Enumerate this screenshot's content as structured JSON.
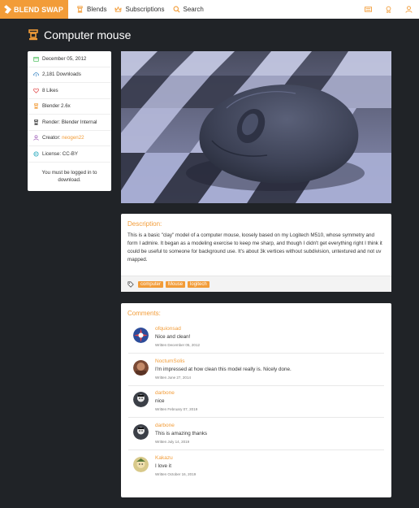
{
  "nav": {
    "brand": "BLEND SWAP",
    "items": [
      {
        "label": "Blends",
        "icon": "blender-icon"
      },
      {
        "label": "Subscriptions",
        "icon": "crown-icon"
      },
      {
        "label": "Search",
        "icon": "search-icon"
      }
    ],
    "right_icons": [
      "newspaper-icon",
      "award-icon",
      "user-icon"
    ]
  },
  "page": {
    "title": "Computer mouse"
  },
  "info": {
    "date": "December 05, 2012",
    "downloads": "2,181 Downloads",
    "likes": "8 Likes",
    "blender": "Blender 2.6x",
    "render": "Render: Blender Internal",
    "creator_label": "Creator:",
    "creator": "neogen22",
    "license": "License: CC-BY",
    "login_note": "You must be logged in to download."
  },
  "description": {
    "title": "Description:",
    "text": "This is a basic \"clay\" model of a computer mouse, loosely based on my Logitech M510, whose symmetry and form I admire. It began as a modeling exercise to keep me sharp, and though I didn't get everything right I think it could be useful to someone for background use. It's about 3k vertices without subdivision, untextured and not uv mapped.",
    "tags": [
      "computer",
      "Mouse",
      "logitech"
    ]
  },
  "comments": {
    "title": "Comments:",
    "items": [
      {
        "author": "ofquionsad",
        "text": "Nice and clean!",
        "date": "Written December 05, 2012"
      },
      {
        "author": "NoctumSolis",
        "text": "I'm impressed at how clean this model really is. Nicely done.",
        "date": "Written June 27, 2014"
      },
      {
        "author": "darbone",
        "text": "nice",
        "date": "Written February 07, 2019"
      },
      {
        "author": "darbone",
        "text": "This is amazing thanks",
        "date": "Written July 14, 2019"
      },
      {
        "author": "Kakazu",
        "text": "I love it",
        "date": "Written October 16, 2019"
      }
    ]
  },
  "colors": {
    "accent": "#f29c38",
    "background": "#202327"
  }
}
